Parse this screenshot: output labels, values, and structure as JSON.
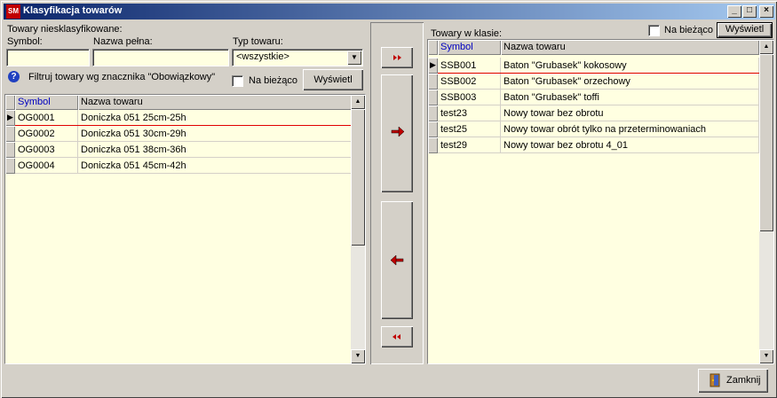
{
  "window": {
    "title": "Klasyfikacja towarów",
    "app_icon_text": "SM",
    "controls": {
      "minimize": "_",
      "maximize": "□",
      "close": "×"
    }
  },
  "left_panel": {
    "section_title": "Towary niesklasyfikowane:",
    "symbol_label": "Symbol:",
    "symbol_value": "",
    "name_label": "Nazwa pełna:",
    "name_value": "",
    "type_label": "Typ towaru:",
    "type_selected": "<wszystkie>",
    "filter_text": "Filtruj towary wg znacznika \"Obowiązkowy\"",
    "current_label": "Na bieżąco",
    "show_button": "Wyświetl",
    "columns": [
      "Symbol",
      "Nazwa towaru"
    ],
    "rows": [
      {
        "symbol": "OG0001",
        "name": "Doniczka 051  25cm-25h"
      },
      {
        "symbol": "OG0002",
        "name": "Doniczka 051  30cm-29h"
      },
      {
        "symbol": "OG0003",
        "name": "Doniczka 051  38cm-36h"
      },
      {
        "symbol": "OG0004",
        "name": "Doniczka 051  45cm-42h"
      }
    ]
  },
  "middle": {
    "add_all_icon": "double-right-arrow-icon",
    "add_icon": "right-arrow-icon",
    "remove_icon": "left-arrow-icon",
    "remove_all_icon": "double-left-arrow-icon"
  },
  "right_panel": {
    "section_title": "Towary w klasie:",
    "current_label": "Na bieżąco",
    "show_button": "Wyświetl",
    "columns": [
      "Symbol",
      "Nazwa towaru"
    ],
    "rows": [
      {
        "symbol": "SSB001",
        "name": "Baton \"Grubasek\" kokosowy"
      },
      {
        "symbol": "SSB002",
        "name": "Baton \"Grubasek\" orzechowy"
      },
      {
        "symbol": "SSB003",
        "name": "Baton \"Grubasek\" toffi"
      },
      {
        "symbol": "test23",
        "name": "Nowy towar bez obrotu"
      },
      {
        "symbol": "test25",
        "name": "Nowy towar obrót tylko na przeterminowaniach"
      },
      {
        "symbol": "test29",
        "name": "Nowy towar bez obrotu 4_01"
      }
    ]
  },
  "footer": {
    "close_button": "Zamknij"
  },
  "colors": {
    "title_start": "#0a246a",
    "grid_bg": "#ffffe1",
    "sort_header": "#0000c0",
    "arrow_red": "#c00000",
    "selection_line": "#e00000"
  }
}
